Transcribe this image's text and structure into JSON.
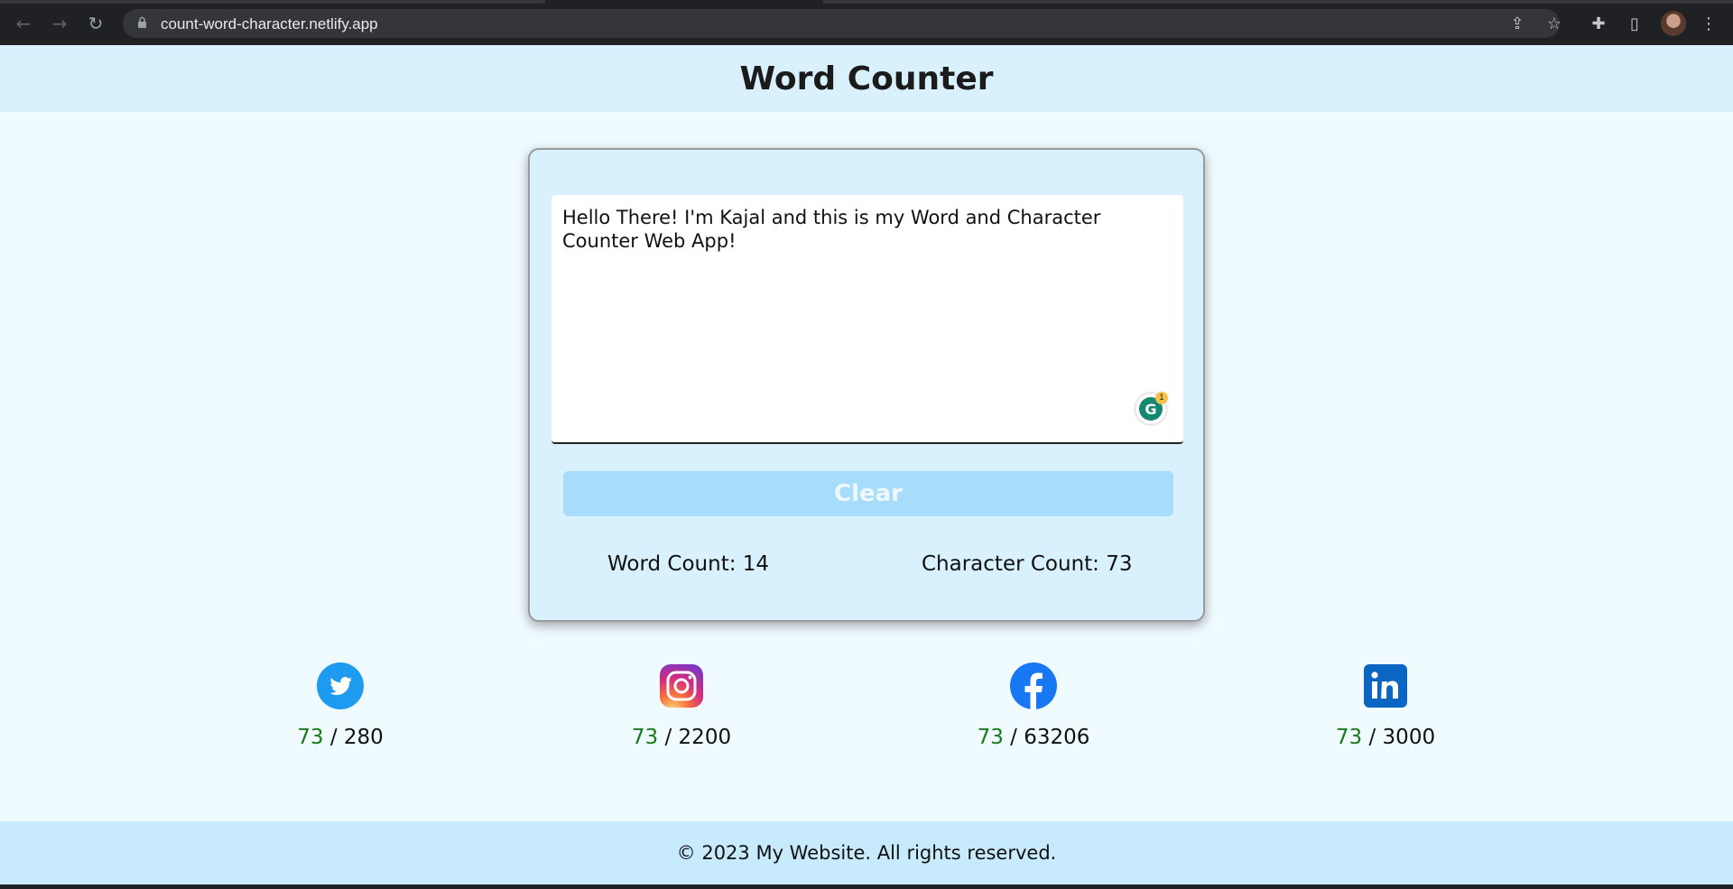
{
  "browser": {
    "url": "count-word-character.netlify.app"
  },
  "header": {
    "title": "Word Counter"
  },
  "editor": {
    "text": "Hello There! I'm Kajal and this is my Word and Character Counter Web App!",
    "grammarly_badge": "1",
    "clear_label": "Clear"
  },
  "stats": {
    "word_count": "Word Count: 14",
    "character_count": "Character Count: 73"
  },
  "socials": [
    {
      "name": "twitter-icon",
      "current": "73",
      "separator": "/",
      "limit": "280"
    },
    {
      "name": "instagram-icon",
      "current": "73",
      "separator": "/",
      "limit": "2200"
    },
    {
      "name": "facebook-icon",
      "current": "73",
      "separator": "/",
      "limit": "63206"
    },
    {
      "name": "linkedin-icon",
      "current": "73",
      "separator": "/",
      "limit": "3000"
    }
  ],
  "footer": {
    "text": "© 2023 My Website. All rights reserved."
  },
  "colors": {
    "header_bg": "#d8f1fd",
    "page_bg": "#f0fbff",
    "button_bg": "#a7dcfa",
    "count_green": "#1a7a1a"
  }
}
